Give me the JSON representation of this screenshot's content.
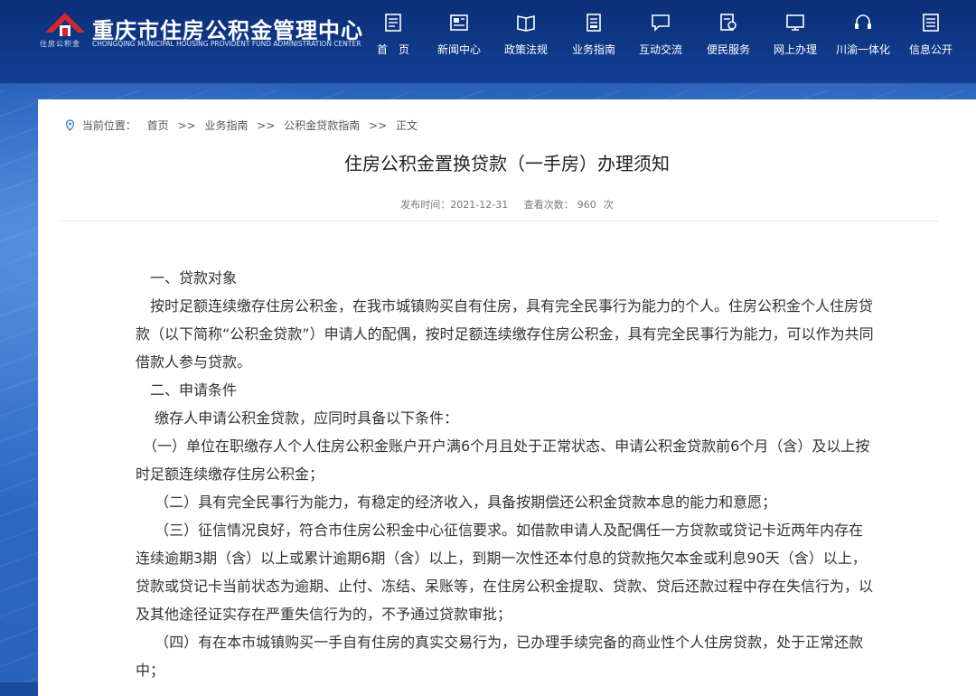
{
  "header": {
    "title": "重庆市住房公积金管理中心",
    "title_en": "CHONGQING MUNICIPAL HOUSING PROVIDENT FUND ADMINISTRATION CENTER",
    "logo_text": "住房公积金"
  },
  "nav": [
    {
      "label": "首　页",
      "icon": "home-doc-icon"
    },
    {
      "label": "新闻中心",
      "icon": "news-icon"
    },
    {
      "label": "政策法规",
      "icon": "book-icon"
    },
    {
      "label": "业务指南",
      "icon": "guide-icon"
    },
    {
      "label": "互动交流",
      "icon": "chat-icon"
    },
    {
      "label": "便民服务",
      "icon": "service-icon"
    },
    {
      "label": "网上办理",
      "icon": "monitor-icon"
    },
    {
      "label": "川渝一体化",
      "icon": "headset-icon"
    },
    {
      "label": "信息公开",
      "icon": "info-icon"
    }
  ],
  "breadcrumb": {
    "prefix": "当前位置：",
    "items": [
      "首页",
      "业务指南",
      "公积金贷款指南",
      "正文"
    ],
    "separator": ">>"
  },
  "article": {
    "title": "住房公积金置换贷款（一手房）办理须知",
    "publish_label": "发布时间：",
    "publish_date": "2021-12-31",
    "views_label": "查看次数：",
    "views": "960",
    "views_unit": "次",
    "paragraphs": [
      "　一、贷款对象",
      "　按时足额连续缴存住房公积金，在我市城镇购买自有住房，具有完全民事行为能力的个人。住房公积金个人住房贷款（以下简称“公积金贷款”）申请人的配偶，按时足额连续缴存住房公积金，具有完全民事行为能力，可以作为共同借款人参与贷款。",
      "　二、申请条件",
      "　 缴存人申请公积金贷款，应同时具备以下条件：",
      "　（一）单位在职缴存人个人住房公积金账户开户满6个月且处于正常状态、申请公积金贷款前6个月（含）及以上按时足额连续缴存住房公积金；",
      "　 （二）具有完全民事行为能力，有稳定的经济收入，具备按期偿还公积金贷款本息的能力和意愿；",
      "　 （三）征信情况良好，符合市住房公积金中心征信要求。如借款申请人及配偶任一方贷款或贷记卡近两年内存在连续逾期3期（含）以上或累计逾期6期（含）以上，到期一次性还本付息的贷款拖欠本金或利息90天（含）以上，贷款或贷记卡当前状态为逾期、止付、冻结、呆账等，在住房公积金提取、贷款、贷后还款过程中存在失信行为，以及其他途径证实存在严重失信行为的，不予通过贷款审批；",
      "　 （四）有在本市城镇购买一手自有住房的真实交易行为，已办理手续完备的商业性个人住房贷款，处于正常还款中；"
    ]
  },
  "colors": {
    "header_bg": "#0b2f78",
    "accent_red": "#d6262b",
    "page_bg": "#2a63be"
  }
}
